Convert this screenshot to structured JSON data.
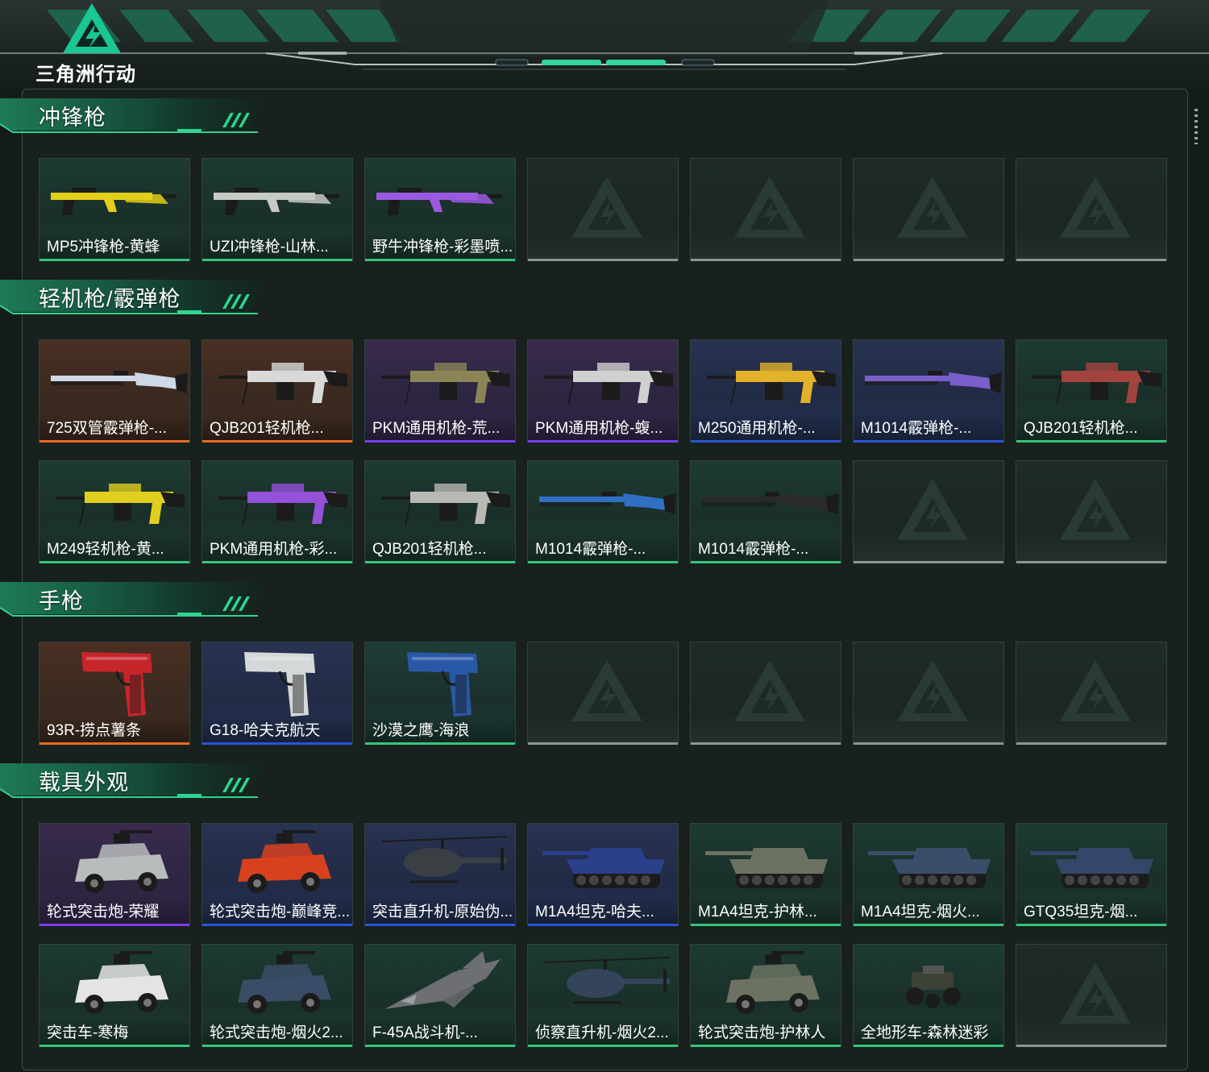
{
  "game": {
    "logo_text": "三角洲行动"
  },
  "colors": {
    "accent": "#2fd58f",
    "orange": "#e86b22",
    "purple": "#7a3cf0",
    "blue": "#2a55d6",
    "green": "#36c47c",
    "empty": "#8c9592"
  },
  "sections": [
    {
      "title": "冲锋枪",
      "rows": [
        [
          {
            "name": "MP5冲锋枪-黄蜂",
            "rarity": "green",
            "icon": "smg-icon",
            "tint": "#e3cf1b"
          },
          {
            "name": "UZI冲锋枪-山林...",
            "rarity": "green",
            "icon": "smg-icon",
            "tint": "#c7c9c4"
          },
          {
            "name": "野牛冲锋枪-彩墨喷...",
            "rarity": "green",
            "icon": "smg-icon",
            "tint": "#9b59e0"
          },
          {
            "empty": true
          },
          {
            "empty": true
          },
          {
            "empty": true
          },
          {
            "empty": true
          }
        ]
      ]
    },
    {
      "title": "轻机枪/霰弹枪",
      "rows": [
        [
          {
            "name": "725双管霰弹枪-...",
            "rarity": "orange",
            "icon": "shotgun-icon",
            "tint": "#cfd8e6"
          },
          {
            "name": "QJB201轻机枪...",
            "rarity": "orange",
            "icon": "lmg-icon",
            "tint": "#d9d9d9"
          },
          {
            "name": "PKM通用机枪-荒...",
            "rarity": "purple",
            "icon": "lmg-icon",
            "tint": "#8a8457"
          },
          {
            "name": "PKM通用机枪-蝮...",
            "rarity": "purple",
            "icon": "lmg-icon",
            "tint": "#d0d0d0"
          },
          {
            "name": "M250通用机枪-...",
            "rarity": "blue",
            "icon": "lmg-icon",
            "tint": "#e2b22a"
          },
          {
            "name": "M1014霰弹枪-...",
            "rarity": "blue",
            "icon": "shotgun-icon",
            "tint": "#7a5ec9"
          },
          {
            "name": "QJB201轻机枪...",
            "rarity": "green",
            "icon": "lmg-icon",
            "tint": "#a3433d"
          }
        ],
        [
          {
            "name": "M249轻机枪-黄...",
            "rarity": "green",
            "icon": "lmg-icon",
            "tint": "#e0cf1e"
          },
          {
            "name": "PKM通用机枪-彩...",
            "rarity": "green",
            "icon": "lmg-icon",
            "tint": "#9352d8"
          },
          {
            "name": "QJB201轻机枪...",
            "rarity": "green",
            "icon": "lmg-icon",
            "tint": "#b9b9b3"
          },
          {
            "name": "M1014霰弹枪-...",
            "rarity": "green",
            "icon": "shotgun-icon",
            "tint": "#2f6fc4"
          },
          {
            "name": "M1014霰弹枪-...",
            "rarity": "green",
            "icon": "shotgun-icon",
            "tint": "#2a2a2a"
          },
          {
            "empty": true
          },
          {
            "empty": true
          }
        ]
      ]
    },
    {
      "title": "手枪",
      "rows": [
        [
          {
            "name": "93R-捞点薯条",
            "rarity": "orange",
            "icon": "pistol-icon",
            "tint": "#c6252a"
          },
          {
            "name": "G18-哈夫克航天",
            "rarity": "blue",
            "icon": "pistol-icon",
            "tint": "#d4d8d8"
          },
          {
            "name": "沙漠之鹰-海浪",
            "rarity": "teal",
            "icon": "pistol-icon",
            "tint": "#2958a6"
          },
          {
            "empty": true
          },
          {
            "empty": true
          },
          {
            "empty": true
          },
          {
            "empty": true
          }
        ]
      ]
    },
    {
      "title": "载具外观",
      "rows": [
        [
          {
            "name": "轮式突击炮-荣耀",
            "rarity": "purple",
            "icon": "armored-car-icon",
            "tint": "#b9bcbd"
          },
          {
            "name": "轮式突击炮-巅峰竞...",
            "rarity": "blue",
            "icon": "armored-car-icon",
            "tint": "#d8411e"
          },
          {
            "name": "突击直升机-原始伪...",
            "rarity": "blue",
            "icon": "helicopter-icon",
            "tint": "#3a3f44"
          },
          {
            "name": "M1A4坦克-哈夫...",
            "rarity": "blue",
            "icon": "tank-icon",
            "tint": "#2b3f8a"
          },
          {
            "name": "M1A4坦克-护林...",
            "rarity": "green",
            "icon": "tank-icon",
            "tint": "#6b7262"
          },
          {
            "name": "M1A4坦克-烟火...",
            "rarity": "green",
            "icon": "tank-icon",
            "tint": "#3c4d6a"
          },
          {
            "name": "GTQ35坦克-烟...",
            "rarity": "green",
            "icon": "tank-icon",
            "tint": "#34476a"
          }
        ],
        [
          {
            "name": "突击车-寒梅",
            "rarity": "green",
            "icon": "armored-car-icon",
            "tint": "#e4e4e4"
          },
          {
            "name": "轮式突击炮-烟火2...",
            "rarity": "green",
            "icon": "armored-car-icon",
            "tint": "#3b4c66"
          },
          {
            "name": "F-45A战斗机-...",
            "rarity": "green",
            "icon": "jet-icon",
            "tint": "#6d6f73"
          },
          {
            "name": "侦察直升机-烟火2...",
            "rarity": "green",
            "icon": "helicopter-icon",
            "tint": "#34445c"
          },
          {
            "name": "轮式突击炮-护林人",
            "rarity": "green",
            "icon": "armored-car-icon",
            "tint": "#6b7261"
          },
          {
            "name": "全地形车-森林迷彩",
            "rarity": "green",
            "icon": "atv-icon",
            "tint": "#3d4236"
          },
          {
            "empty": true
          }
        ]
      ]
    }
  ]
}
